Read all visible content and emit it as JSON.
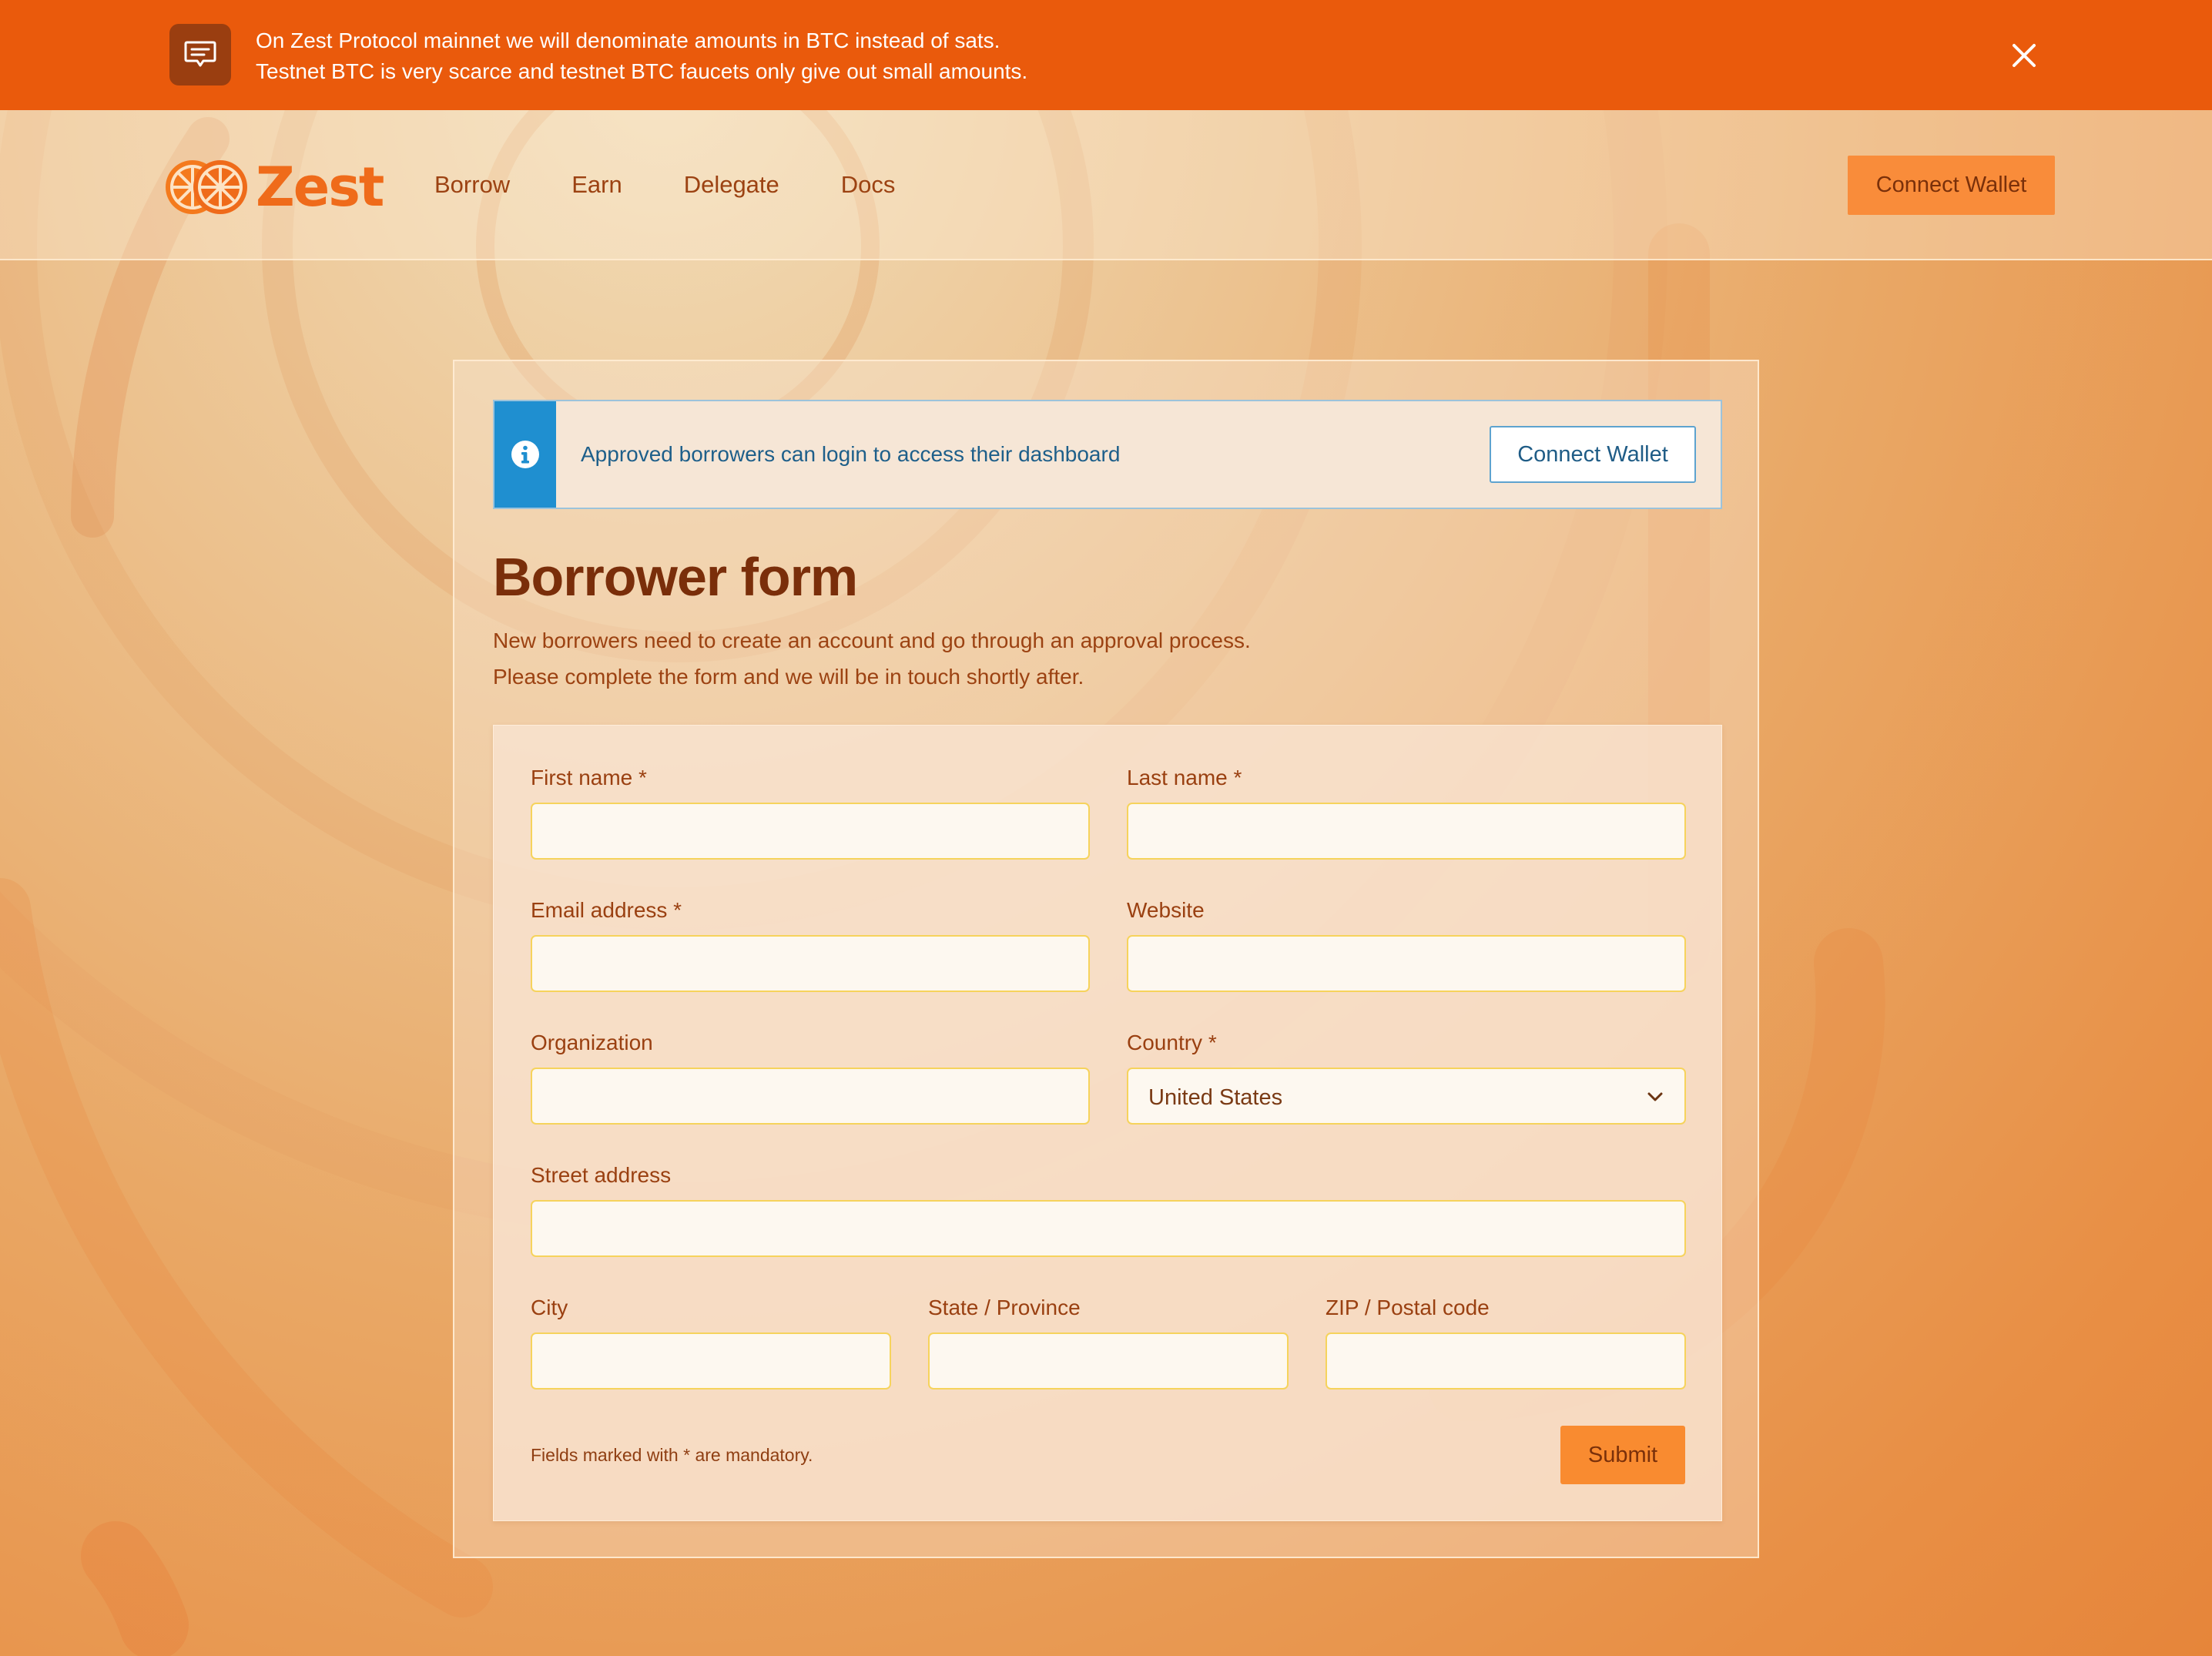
{
  "banner": {
    "line1": "On Zest Protocol mainnet we will denominate amounts in BTC instead of sats.",
    "line2": "Testnet BTC is very scarce and testnet BTC faucets only give out small amounts.",
    "icon": "message-icon",
    "close_icon": "close-icon"
  },
  "header": {
    "logo_text": "Zest",
    "nav": [
      "Borrow",
      "Earn",
      "Delegate",
      "Docs"
    ],
    "connect_label": "Connect Wallet"
  },
  "info": {
    "icon": "info-icon",
    "text": "Approved borrowers can login to access their dashboard",
    "connect_label": "Connect Wallet"
  },
  "form": {
    "title": "Borrower form",
    "subtitle_line1": "New borrowers need to create an account and go through an approval process.",
    "subtitle_line2": "Please complete the form and we will be in touch shortly after.",
    "fields": {
      "first_name": "First name *",
      "last_name": "Last name *",
      "email": "Email address *",
      "website": "Website",
      "organization": "Organization",
      "country": "Country *",
      "street": "Street address",
      "city": "City",
      "state": "State / Province",
      "zip": "ZIP / Postal code"
    },
    "country_value": "United States",
    "footnote": "Fields marked with * are mandatory.",
    "submit_label": "Submit"
  },
  "colors": {
    "banner": "#ea5a0c",
    "accent": "#f98b30",
    "info_strip": "#1f8fd0",
    "input_border": "#f6d35c"
  }
}
